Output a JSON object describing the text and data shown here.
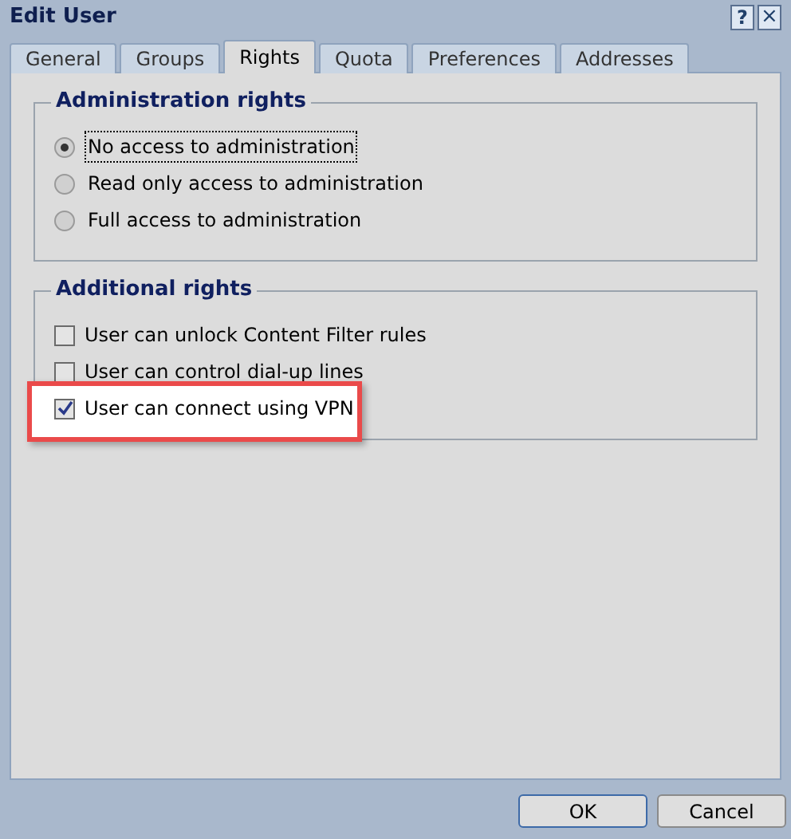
{
  "window": {
    "title": "Edit User",
    "help_button": "?",
    "close_button": "×"
  },
  "tabs": [
    {
      "label": "General",
      "selected": false
    },
    {
      "label": "Groups",
      "selected": false
    },
    {
      "label": "Rights",
      "selected": true
    },
    {
      "label": "Quota",
      "selected": false
    },
    {
      "label": "Preferences",
      "selected": false
    },
    {
      "label": "Addresses",
      "selected": false
    }
  ],
  "administration_rights": {
    "title": "Administration rights",
    "options": [
      {
        "label": "No access to administration",
        "selected": true,
        "focused": true
      },
      {
        "label": "Read only access to administration",
        "selected": false,
        "focused": false
      },
      {
        "label": "Full access to administration",
        "selected": false,
        "focused": false
      }
    ]
  },
  "additional_rights": {
    "title": "Additional rights",
    "options": [
      {
        "label": "User can unlock Content Filter rules",
        "checked": false,
        "highlighted": false
      },
      {
        "label": "User can control dial-up lines",
        "checked": false,
        "highlighted": false
      },
      {
        "label": "User can connect using VPN",
        "checked": true,
        "highlighted": true
      }
    ]
  },
  "buttons": [
    {
      "label": "OK",
      "default": true
    },
    {
      "label": "Cancel",
      "default": false
    }
  ]
}
